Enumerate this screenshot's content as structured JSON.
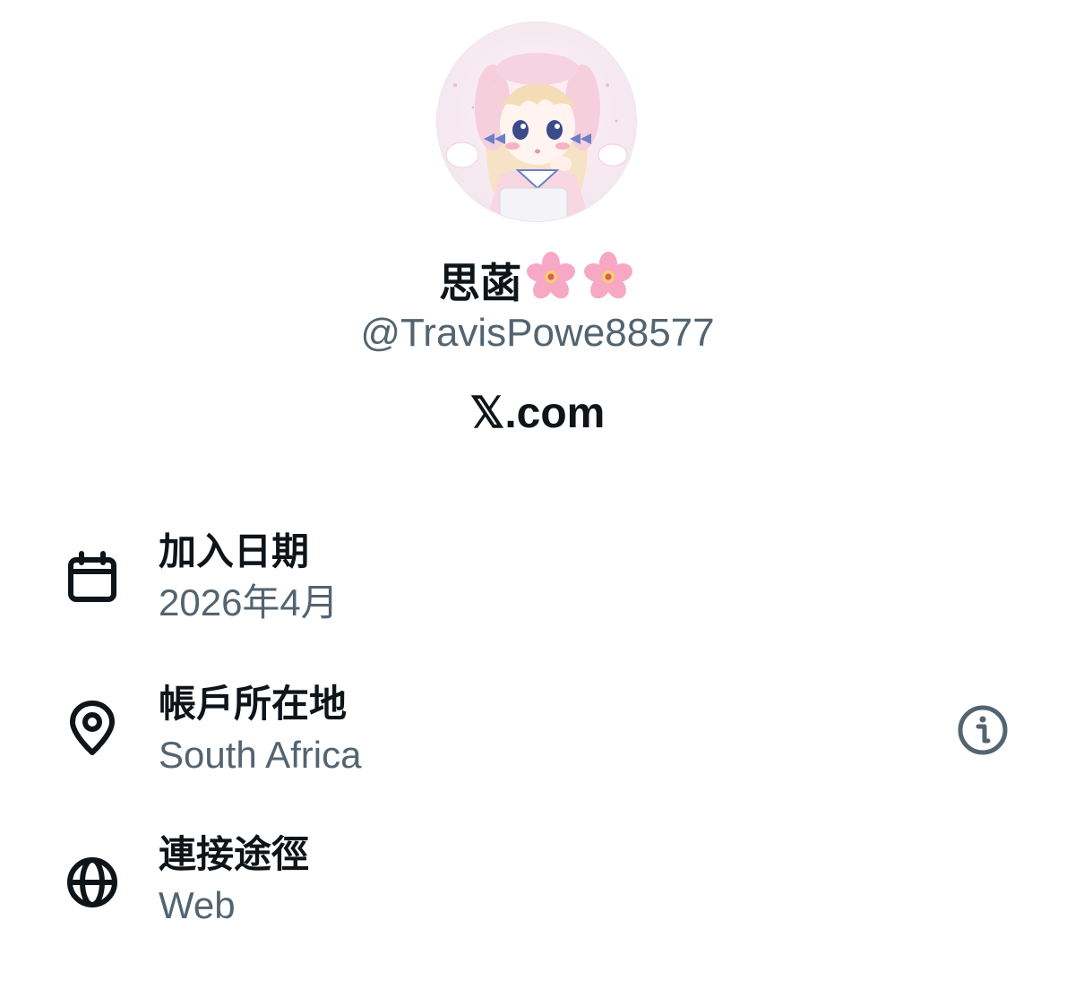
{
  "profile": {
    "display_name": "思菡",
    "name_emoji": [
      "cherry-blossom-icon",
      "cherry-blossom-icon"
    ],
    "handle": "@TravisPowe88577",
    "platform": "𝕏.com"
  },
  "about": {
    "items": [
      {
        "icon": "calendar-icon",
        "label": "加入日期",
        "value": "2026年4月"
      },
      {
        "icon": "location-pin-icon",
        "label": "帳戶所在地",
        "value": "South Africa",
        "has_info": true
      },
      {
        "icon": "globe-icon",
        "label": "連接途徑",
        "value": "Web"
      }
    ]
  },
  "colors": {
    "primary_text": "#0f1419",
    "secondary_text": "#536471",
    "background": "#ffffff",
    "flower_pink": "#f7a8c4"
  }
}
